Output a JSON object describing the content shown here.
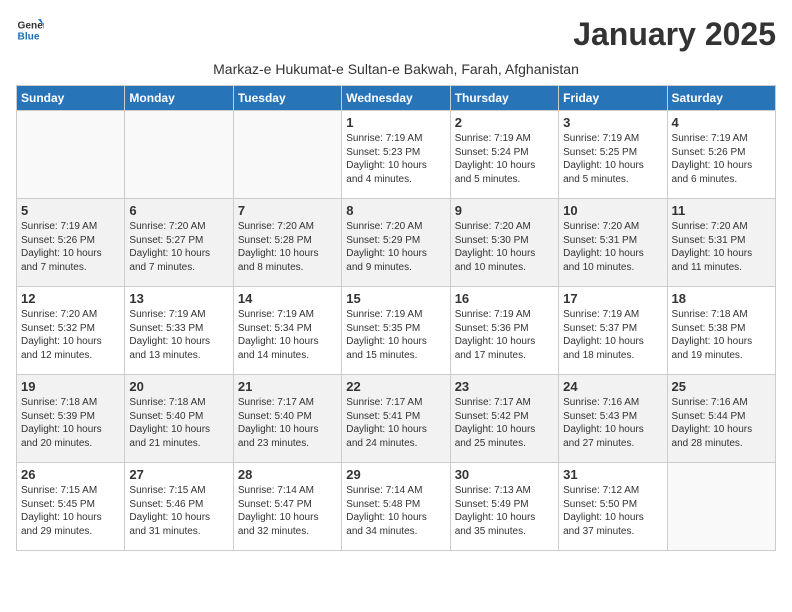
{
  "logo": {
    "line1": "General",
    "line2": "Blue"
  },
  "title": "January 2025",
  "subtitle": "Markaz-e Hukumat-e Sultan-e Bakwah, Farah, Afghanistan",
  "headers": [
    "Sunday",
    "Monday",
    "Tuesday",
    "Wednesday",
    "Thursday",
    "Friday",
    "Saturday"
  ],
  "weeks": [
    [
      {
        "num": "",
        "info": ""
      },
      {
        "num": "",
        "info": ""
      },
      {
        "num": "",
        "info": ""
      },
      {
        "num": "1",
        "info": "Sunrise: 7:19 AM\nSunset: 5:23 PM\nDaylight: 10 hours\nand 4 minutes."
      },
      {
        "num": "2",
        "info": "Sunrise: 7:19 AM\nSunset: 5:24 PM\nDaylight: 10 hours\nand 5 minutes."
      },
      {
        "num": "3",
        "info": "Sunrise: 7:19 AM\nSunset: 5:25 PM\nDaylight: 10 hours\nand 5 minutes."
      },
      {
        "num": "4",
        "info": "Sunrise: 7:19 AM\nSunset: 5:26 PM\nDaylight: 10 hours\nand 6 minutes."
      }
    ],
    [
      {
        "num": "5",
        "info": "Sunrise: 7:19 AM\nSunset: 5:26 PM\nDaylight: 10 hours\nand 7 minutes."
      },
      {
        "num": "6",
        "info": "Sunrise: 7:20 AM\nSunset: 5:27 PM\nDaylight: 10 hours\nand 7 minutes."
      },
      {
        "num": "7",
        "info": "Sunrise: 7:20 AM\nSunset: 5:28 PM\nDaylight: 10 hours\nand 8 minutes."
      },
      {
        "num": "8",
        "info": "Sunrise: 7:20 AM\nSunset: 5:29 PM\nDaylight: 10 hours\nand 9 minutes."
      },
      {
        "num": "9",
        "info": "Sunrise: 7:20 AM\nSunset: 5:30 PM\nDaylight: 10 hours\nand 10 minutes."
      },
      {
        "num": "10",
        "info": "Sunrise: 7:20 AM\nSunset: 5:31 PM\nDaylight: 10 hours\nand 10 minutes."
      },
      {
        "num": "11",
        "info": "Sunrise: 7:20 AM\nSunset: 5:31 PM\nDaylight: 10 hours\nand 11 minutes."
      }
    ],
    [
      {
        "num": "12",
        "info": "Sunrise: 7:20 AM\nSunset: 5:32 PM\nDaylight: 10 hours\nand 12 minutes."
      },
      {
        "num": "13",
        "info": "Sunrise: 7:19 AM\nSunset: 5:33 PM\nDaylight: 10 hours\nand 13 minutes."
      },
      {
        "num": "14",
        "info": "Sunrise: 7:19 AM\nSunset: 5:34 PM\nDaylight: 10 hours\nand 14 minutes."
      },
      {
        "num": "15",
        "info": "Sunrise: 7:19 AM\nSunset: 5:35 PM\nDaylight: 10 hours\nand 15 minutes."
      },
      {
        "num": "16",
        "info": "Sunrise: 7:19 AM\nSunset: 5:36 PM\nDaylight: 10 hours\nand 17 minutes."
      },
      {
        "num": "17",
        "info": "Sunrise: 7:19 AM\nSunset: 5:37 PM\nDaylight: 10 hours\nand 18 minutes."
      },
      {
        "num": "18",
        "info": "Sunrise: 7:18 AM\nSunset: 5:38 PM\nDaylight: 10 hours\nand 19 minutes."
      }
    ],
    [
      {
        "num": "19",
        "info": "Sunrise: 7:18 AM\nSunset: 5:39 PM\nDaylight: 10 hours\nand 20 minutes."
      },
      {
        "num": "20",
        "info": "Sunrise: 7:18 AM\nSunset: 5:40 PM\nDaylight: 10 hours\nand 21 minutes."
      },
      {
        "num": "21",
        "info": "Sunrise: 7:17 AM\nSunset: 5:40 PM\nDaylight: 10 hours\nand 23 minutes."
      },
      {
        "num": "22",
        "info": "Sunrise: 7:17 AM\nSunset: 5:41 PM\nDaylight: 10 hours\nand 24 minutes."
      },
      {
        "num": "23",
        "info": "Sunrise: 7:17 AM\nSunset: 5:42 PM\nDaylight: 10 hours\nand 25 minutes."
      },
      {
        "num": "24",
        "info": "Sunrise: 7:16 AM\nSunset: 5:43 PM\nDaylight: 10 hours\nand 27 minutes."
      },
      {
        "num": "25",
        "info": "Sunrise: 7:16 AM\nSunset: 5:44 PM\nDaylight: 10 hours\nand 28 minutes."
      }
    ],
    [
      {
        "num": "26",
        "info": "Sunrise: 7:15 AM\nSunset: 5:45 PM\nDaylight: 10 hours\nand 29 minutes."
      },
      {
        "num": "27",
        "info": "Sunrise: 7:15 AM\nSunset: 5:46 PM\nDaylight: 10 hours\nand 31 minutes."
      },
      {
        "num": "28",
        "info": "Sunrise: 7:14 AM\nSunset: 5:47 PM\nDaylight: 10 hours\nand 32 minutes."
      },
      {
        "num": "29",
        "info": "Sunrise: 7:14 AM\nSunset: 5:48 PM\nDaylight: 10 hours\nand 34 minutes."
      },
      {
        "num": "30",
        "info": "Sunrise: 7:13 AM\nSunset: 5:49 PM\nDaylight: 10 hours\nand 35 minutes."
      },
      {
        "num": "31",
        "info": "Sunrise: 7:12 AM\nSunset: 5:50 PM\nDaylight: 10 hours\nand 37 minutes."
      },
      {
        "num": "",
        "info": ""
      }
    ]
  ]
}
